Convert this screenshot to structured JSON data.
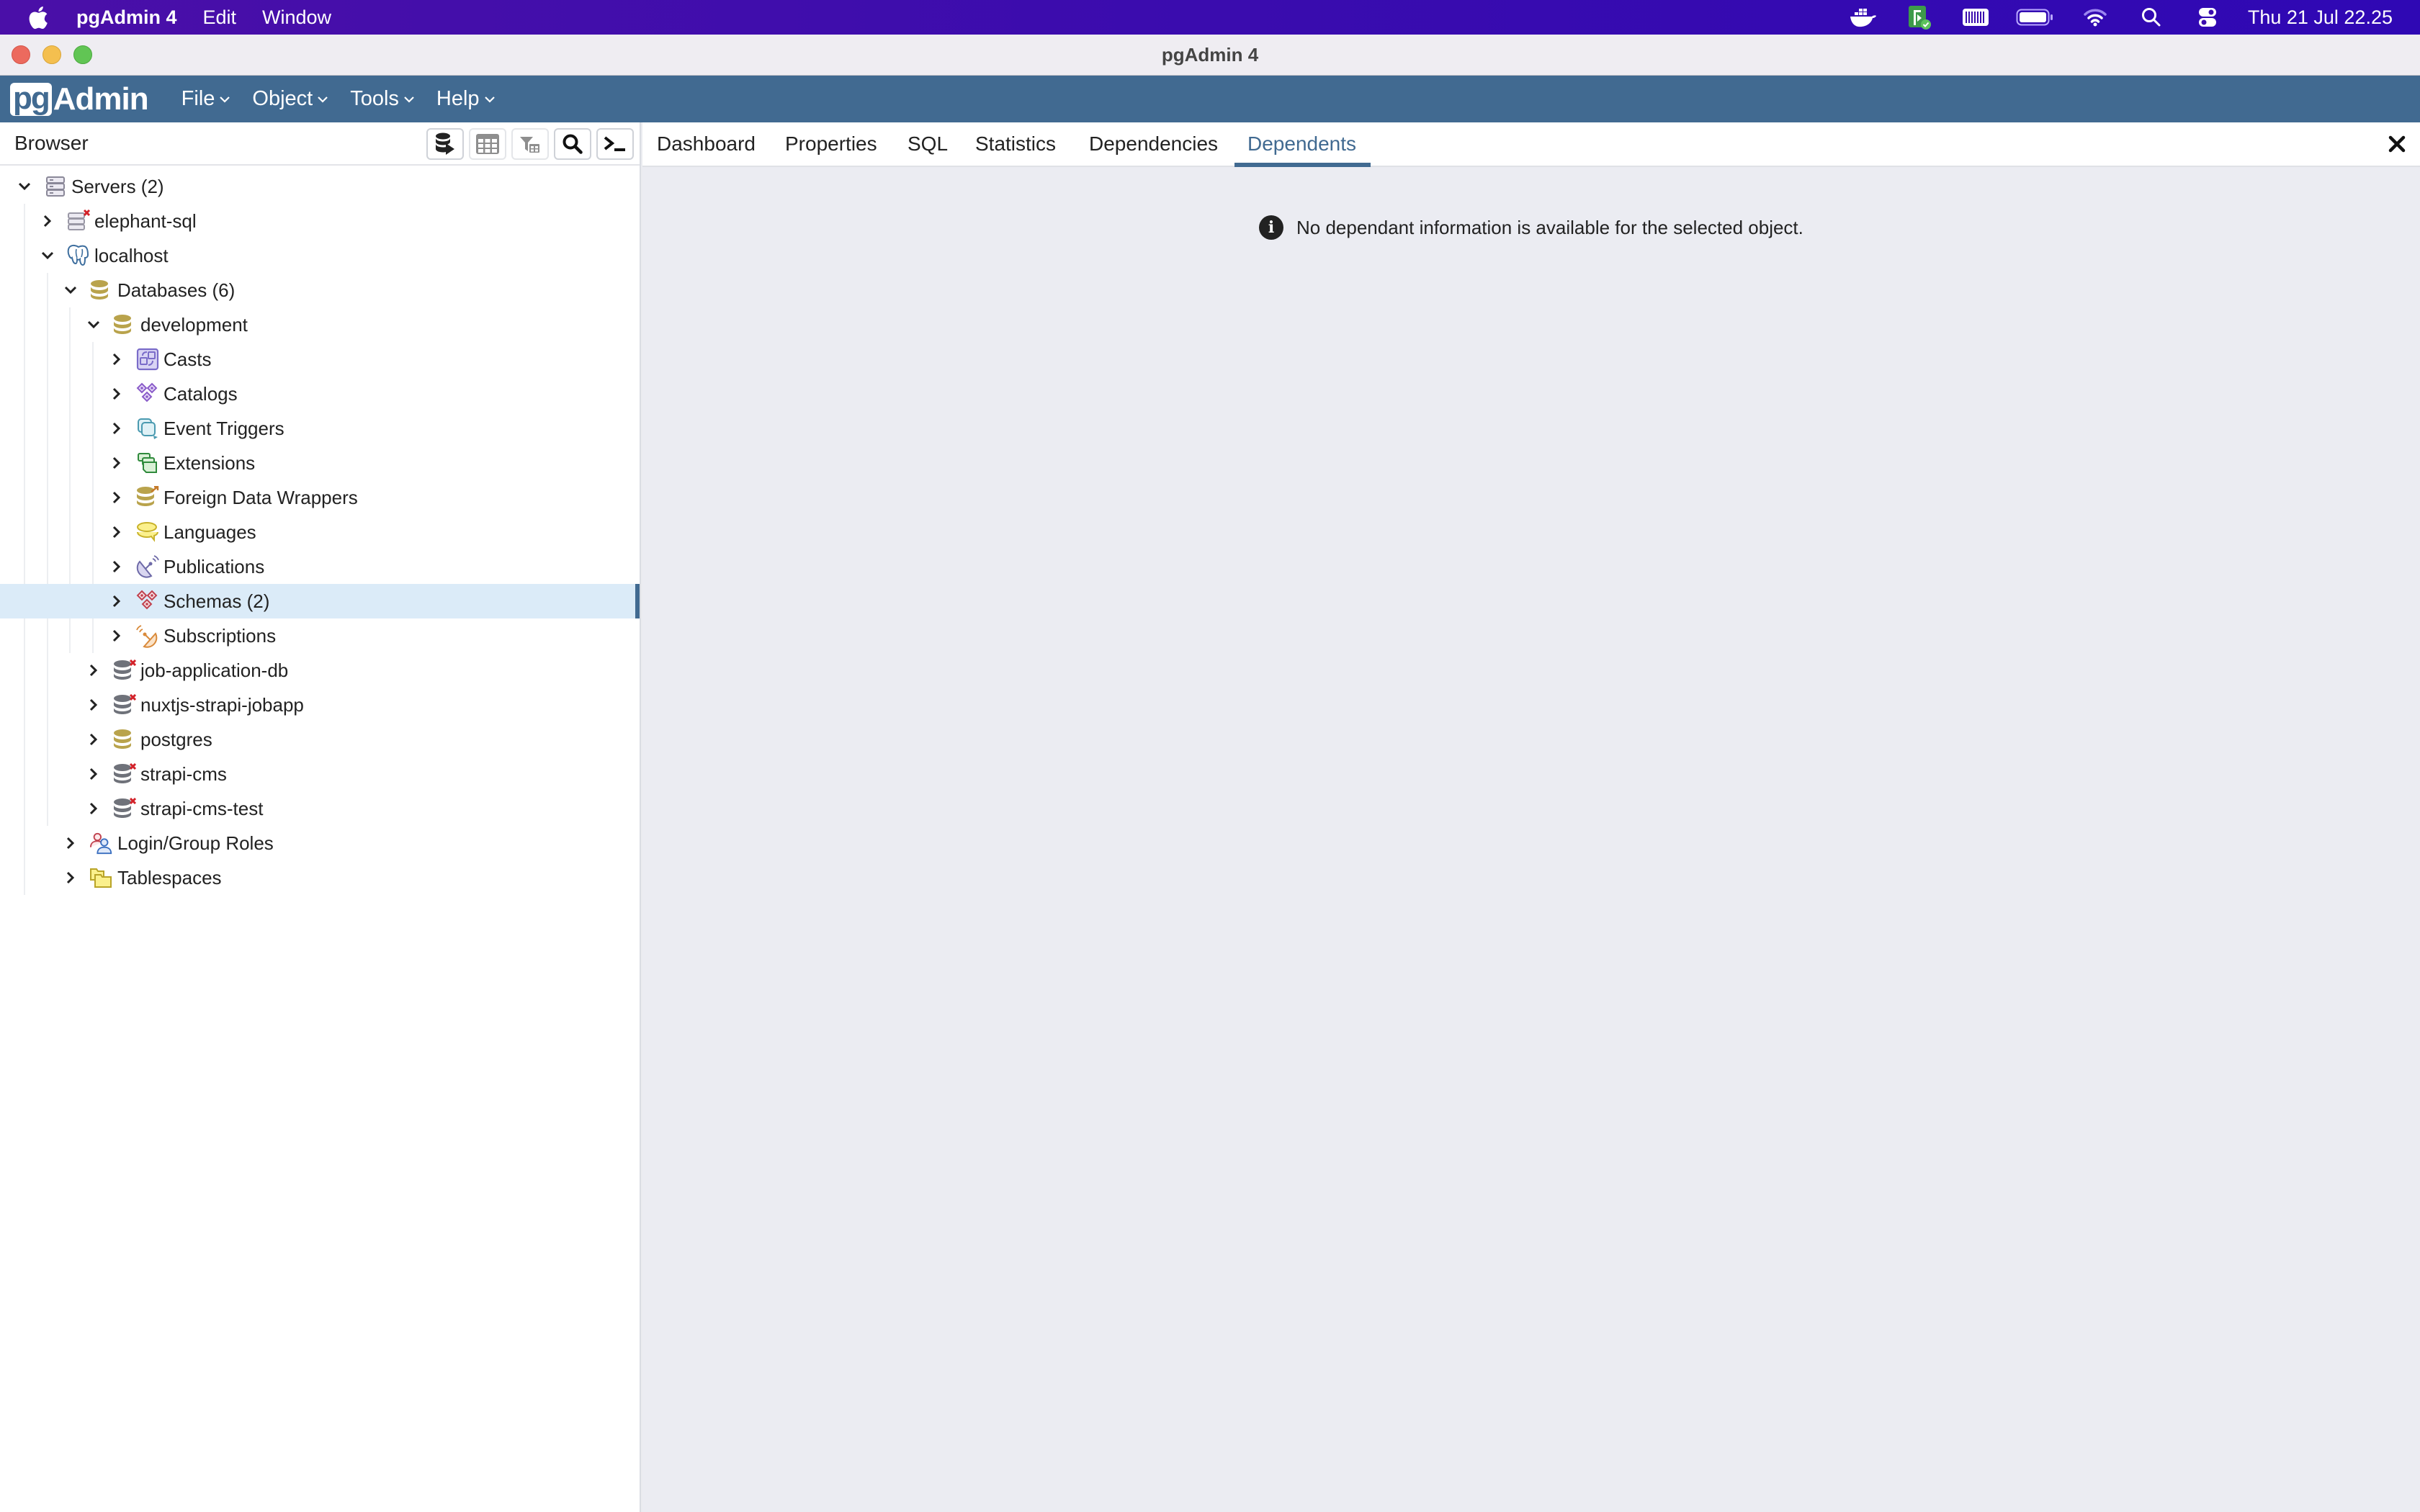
{
  "menubar": {
    "apple_icon": "apple-logo-icon",
    "app_name": "pgAdmin 4",
    "items": [
      "Edit",
      "Window"
    ],
    "status_icons": [
      "docker-icon",
      "script-runner-icon",
      "barcode-icon",
      "battery-icon",
      "wifi-icon",
      "spotlight-search-icon",
      "control-center-icon"
    ],
    "clock": "Thu 21 Jul  22.25"
  },
  "window": {
    "title": "pgAdmin 4"
  },
  "app_header": {
    "logo_pg": "pg",
    "logo_admin": "Admin",
    "menu": [
      {
        "label": "File"
      },
      {
        "label": "Object"
      },
      {
        "label": "Tools"
      },
      {
        "label": "Help"
      }
    ]
  },
  "browser": {
    "title": "Browser",
    "toolbar": [
      {
        "name": "query-tool-button",
        "icon": "database-play-icon",
        "enabled": true
      },
      {
        "name": "view-data-button",
        "icon": "table-grid-icon",
        "enabled": false
      },
      {
        "name": "filtered-rows-button",
        "icon": "filter-table-icon",
        "enabled": false
      },
      {
        "name": "search-objects-button",
        "icon": "search-icon",
        "enabled": true
      },
      {
        "name": "psql-tool-button",
        "icon": "terminal-icon",
        "enabled": true
      }
    ],
    "tree": [
      {
        "label": "Servers (2)",
        "depth": 0,
        "expanded": true,
        "icon": "servers-icon"
      },
      {
        "label": "elephant-sql",
        "depth": 1,
        "expanded": false,
        "icon": "server-disconnected-icon"
      },
      {
        "label": "localhost",
        "depth": 1,
        "expanded": true,
        "icon": "postgres-elephant-icon"
      },
      {
        "label": "Databases (6)",
        "depth": 2,
        "expanded": true,
        "icon": "databases-icon"
      },
      {
        "label": "development",
        "depth": 3,
        "expanded": true,
        "icon": "database-icon"
      },
      {
        "label": "Casts",
        "depth": 4,
        "expanded": false,
        "icon": "casts-icon"
      },
      {
        "label": "Catalogs",
        "depth": 4,
        "expanded": false,
        "icon": "catalogs-icon"
      },
      {
        "label": "Event Triggers",
        "depth": 4,
        "expanded": false,
        "icon": "event-triggers-icon"
      },
      {
        "label": "Extensions",
        "depth": 4,
        "expanded": false,
        "icon": "extensions-icon"
      },
      {
        "label": "Foreign Data Wrappers",
        "depth": 4,
        "expanded": false,
        "icon": "foreign-data-wrappers-icon"
      },
      {
        "label": "Languages",
        "depth": 4,
        "expanded": false,
        "icon": "languages-icon"
      },
      {
        "label": "Publications",
        "depth": 4,
        "expanded": false,
        "icon": "publications-icon"
      },
      {
        "label": "Schemas (2)",
        "depth": 4,
        "expanded": false,
        "icon": "schemas-icon",
        "selected": true
      },
      {
        "label": "Subscriptions",
        "depth": 4,
        "expanded": false,
        "icon": "subscriptions-icon"
      },
      {
        "label": "job-application-db",
        "depth": 3,
        "expanded": false,
        "icon": "database-disconnected-icon"
      },
      {
        "label": "nuxtjs-strapi-jobapp",
        "depth": 3,
        "expanded": false,
        "icon": "database-disconnected-icon"
      },
      {
        "label": "postgres",
        "depth": 3,
        "expanded": false,
        "icon": "database-icon"
      },
      {
        "label": "strapi-cms",
        "depth": 3,
        "expanded": false,
        "icon": "database-disconnected-icon"
      },
      {
        "label": "strapi-cms-test",
        "depth": 3,
        "expanded": false,
        "icon": "database-disconnected-icon"
      },
      {
        "label": "Login/Group Roles",
        "depth": 2,
        "expanded": false,
        "icon": "login-group-roles-icon"
      },
      {
        "label": "Tablespaces",
        "depth": 2,
        "expanded": false,
        "icon": "tablespaces-icon"
      }
    ]
  },
  "main": {
    "tabs": [
      {
        "label": "Dashboard",
        "active": false
      },
      {
        "label": "Properties",
        "active": false
      },
      {
        "label": "SQL",
        "active": false
      },
      {
        "label": "Statistics",
        "active": false
      },
      {
        "label": "Dependencies",
        "active": false
      },
      {
        "label": "Dependents",
        "active": true
      }
    ],
    "info_icon": "info-icon",
    "message": "No dependant information is available for the selected object."
  },
  "colors": {
    "accent": "#416a91",
    "selection": "#dbebf8",
    "menubar": "#3a0cae",
    "content_bg": "#ebecf2"
  }
}
